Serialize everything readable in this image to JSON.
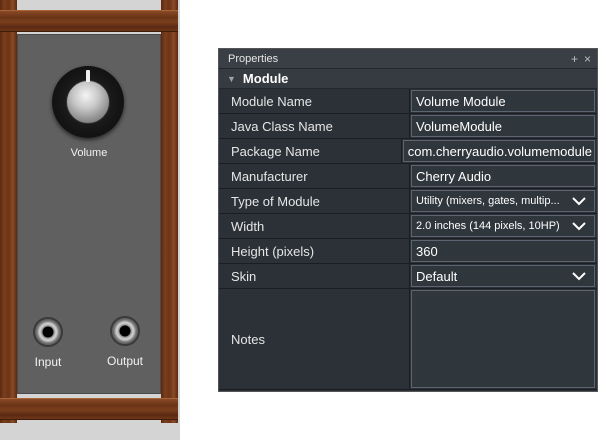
{
  "module_preview": {
    "knob_label": "Volume",
    "input_label": "Input",
    "output_label": "Output"
  },
  "panel": {
    "title": "Properties",
    "controls": {
      "add": "+",
      "close": "×"
    },
    "section": {
      "label": "Module"
    },
    "rows": [
      {
        "key": "Module Name",
        "value": "Volume Module",
        "dropdown": false
      },
      {
        "key": "Java Class Name",
        "value": "VolumeModule",
        "dropdown": false
      },
      {
        "key": "Package Name",
        "value": "com.cherryaudio.volumemodule",
        "dropdown": false
      },
      {
        "key": "Manufacturer",
        "value": "Cherry Audio",
        "dropdown": false
      },
      {
        "key": "Type of Module",
        "value": "Utility (mixers, gates, multip...",
        "dropdown": true
      },
      {
        "key": "Width",
        "value": "2.0 inches (144 pixels, 10HP)",
        "dropdown": true
      },
      {
        "key": "Height (pixels)",
        "value": "360",
        "dropdown": false
      },
      {
        "key": "Skin",
        "value": "Default",
        "dropdown": true
      },
      {
        "key": "Notes",
        "value": "",
        "dropdown": false
      }
    ]
  }
}
